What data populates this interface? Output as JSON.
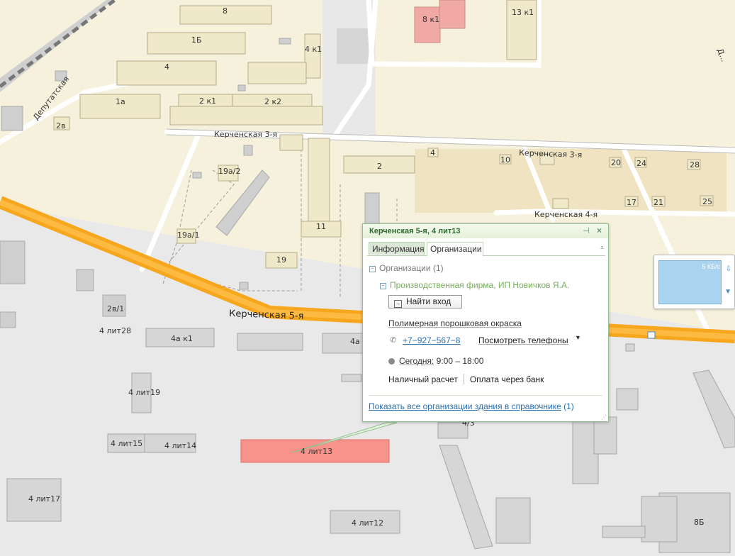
{
  "streets": {
    "deputatskaya": "Депутатская",
    "kerch3_west": "Керченская 3-я",
    "kerch3_east": "Керченская 3-я",
    "kerch4": "Керченская 4-я",
    "kerch5": "Керченская 5-я",
    "diag": "Д..."
  },
  "buildings": {
    "b8": "8",
    "b8k1": "8 к1",
    "b13k1": "13 к1",
    "b1b": "1Б",
    "b4k1": "4 к1",
    "b4": "4",
    "b1a": "1а",
    "b2k1": "2 к1",
    "b2k2": "2 к2",
    "b2v": "2в",
    "b4s": "4",
    "b10": "10",
    "b20": "20",
    "b24": "24",
    "b28": "28",
    "b2": "2",
    "b19a2": "19а/2",
    "b17": "17",
    "b21": "21",
    "b25": "25",
    "b11": "11",
    "b19a1": "19а/1",
    "b19": "19",
    "b2v1": "2в/1",
    "b4lit28": "4 лит28",
    "b4ak1": "4а к1",
    "b4a": "4а",
    "b4lit19": "4 лит19",
    "b4lit15": "4 лит15",
    "b4lit14": "4 лит14",
    "b4lit13": "4 лит13",
    "b4lit17": "4 лит17",
    "b4lit12": "4 лит12",
    "b8b": "8Б",
    "b43": "4/3"
  },
  "popup": {
    "title": "Керченская 5-я, 4 лит13",
    "tab_info": "Информация",
    "tab_org": "Организации",
    "org_section": "Организации (1)",
    "firm": "Производственная фирма, ИП Новичков Я.А.",
    "enter_btn": "Найти вход",
    "category": "Полимерная порошковая окраска",
    "phone": "+7−927−567−8",
    "show_phones": "Посмотреть телефоны",
    "hours_label": "Сегодня:",
    "hours_value": "9:00 – 18:00",
    "pay_cash": "Наличный расчет",
    "pay_bank": "Оплата через банк",
    "show_all": "Показать все организации здания в справочнике",
    "show_all_count": "(1)"
  },
  "minimap": {
    "traffic": "5 КБ/с"
  },
  "colors": {
    "residential": "#f6f1dc",
    "industrial": "#e9e9e9",
    "road_main": "#f7a71e",
    "highlight": "#f7938a",
    "accent": "#2a6fb0",
    "firm": "#77ad5c"
  }
}
